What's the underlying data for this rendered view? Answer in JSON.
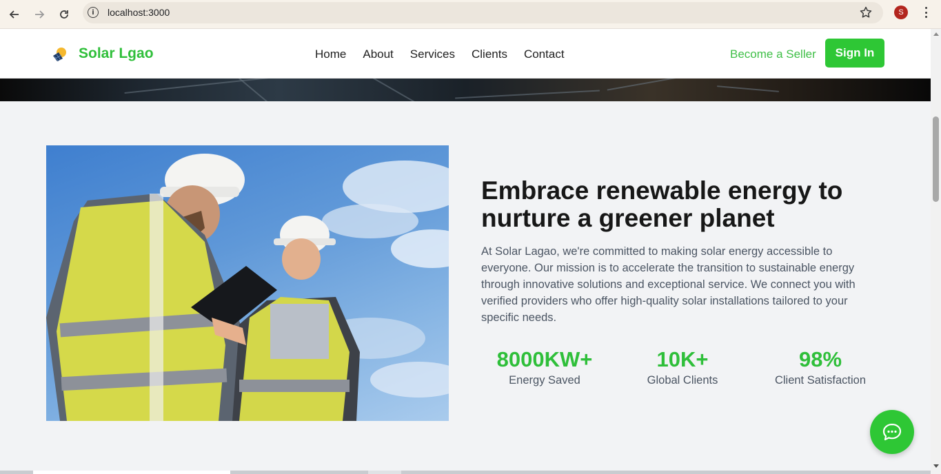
{
  "browser": {
    "url": "localhost:3000",
    "profile_initial": "S"
  },
  "header": {
    "brand": "Solar Lgao",
    "nav": [
      "Home",
      "About",
      "Services",
      "Clients",
      "Contact"
    ],
    "become_seller": "Become a Seller",
    "sign_in": "Sign In"
  },
  "about": {
    "headline": "Embrace renewable energy to nurture a greener planet",
    "paragraph": "At Solar Lagao, we're committed to making solar energy accessible to everyone. Our mission is to accelerate the transition to sustainable energy through innovative solutions and exceptional service. We connect you with verified providers who offer high-quality solar installations tailored to your specific needs.",
    "stats": [
      {
        "value": "8000KW+",
        "label": "Energy Saved"
      },
      {
        "value": "10K+",
        "label": "Global Clients"
      },
      {
        "value": "98%",
        "label": "Client Satisfaction"
      }
    ]
  },
  "colors": {
    "brand_green": "#2fbf3a",
    "button_green": "#2ec735",
    "page_bg": "#f2f3f5"
  }
}
